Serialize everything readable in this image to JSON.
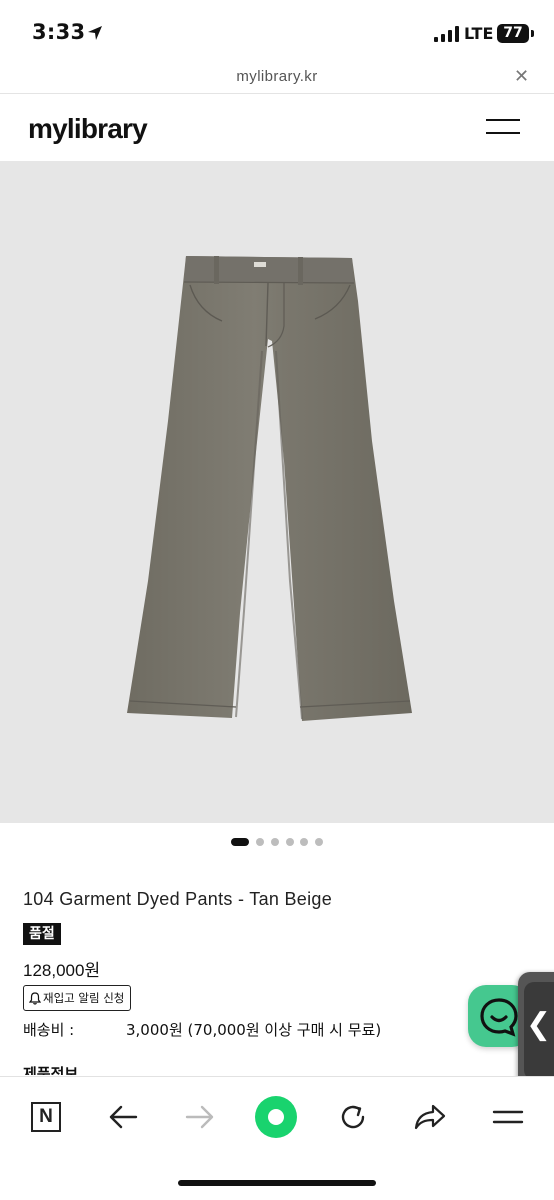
{
  "status_bar": {
    "time": "3:33",
    "network": "LTE",
    "battery": "77"
  },
  "url_bar": {
    "domain": "mylibrary.kr",
    "close_glyph": "✕"
  },
  "site_header": {
    "logo": "mylibrary",
    "menu_icon": "hamburger-menu-icon"
  },
  "carousel": {
    "total": 6,
    "active_index": 0
  },
  "product": {
    "title": "104 Garment Dyed Pants - Tan Beige",
    "soldout_badge": "품절",
    "price": "128,000원",
    "restock_button": "재입고 알림 신청",
    "shipping_label": "배송비 :",
    "shipping_value": "3,000원 (70,000원 이상 구매 시 무료)",
    "detail_heading": "제품정보"
  },
  "floating": {
    "chat_icon": "chat-bubble-icon",
    "side_handle_glyph": "❮"
  },
  "toolbar": {
    "n_label": "N",
    "items": [
      "naver-icon",
      "back-arrow-icon",
      "forward-arrow-icon",
      "green-dot-icon",
      "reload-icon",
      "share-icon",
      "menu-icon"
    ]
  },
  "colors": {
    "image_bg": "#e6e6e6",
    "pants": "#7a776d",
    "chat_green": "#45c88f",
    "toolbar_green": "#19d36e"
  }
}
